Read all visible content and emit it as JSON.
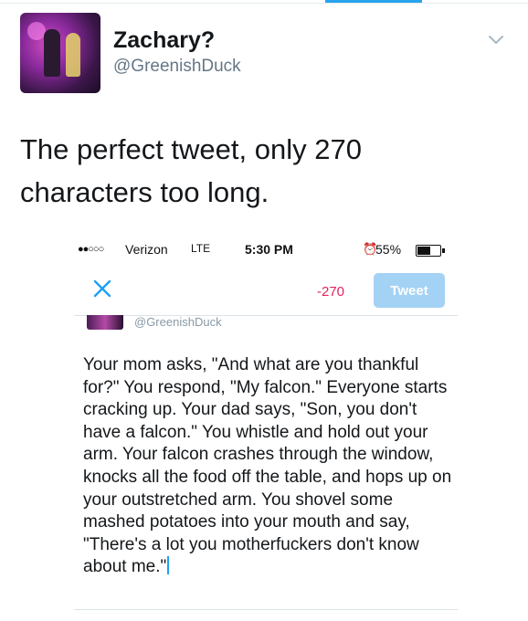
{
  "tweet": {
    "author_name": "Zachary?",
    "author_handle": "@GreenishDuck",
    "text_line1": "The perfect tweet, only 270",
    "text_line2": "characters too long."
  },
  "embedded_screenshot": {
    "status_bar": {
      "signal": "●●○○○",
      "carrier": "Verizon",
      "network": "LTE",
      "time": "5:30 PM",
      "alarm": "⏰",
      "battery_percent": "55%",
      "battery_level": 0.55
    },
    "composer": {
      "close_icon": "close-icon",
      "character_count": "-270",
      "tweet_button": "Tweet",
      "handle": "@GreenishDuck",
      "text": "Your mom asks, \"And what are you thankful for?\" You respond, \"My falcon.\" Everyone starts cracking up. Your dad says, \"Son, you don't have a falcon.\" You whistle and hold out your arm. Your falcon crashes through the window, knocks all the food off the table, and hops up on your outstretched arm. You shovel some mashed potatoes into your mouth and say, \"There's a lot you motherfuckers don't know about me.\""
    }
  },
  "colors": {
    "accent": "#2aa3ef",
    "counter_negative": "#e0245e",
    "tweet_button_disabled": "#a3d2f5",
    "secondary_text": "#657786"
  }
}
